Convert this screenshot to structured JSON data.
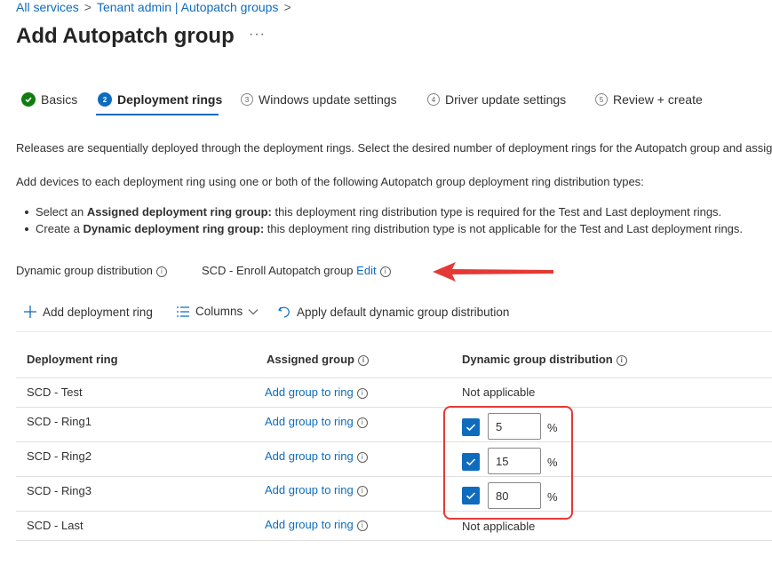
{
  "breadcrumb": [
    "All services",
    "Tenant admin | Autopatch groups"
  ],
  "page_title": "Add Autopatch group",
  "more_label": "···",
  "tabs": [
    {
      "label": "Basics",
      "num": "",
      "state": "done"
    },
    {
      "label": "Deployment rings",
      "num": "2",
      "state": "active"
    },
    {
      "label": "Windows update settings",
      "num": "3",
      "state": "pending"
    },
    {
      "label": "Driver update settings",
      "num": "4",
      "state": "pending"
    },
    {
      "label": "Review + create",
      "num": "5",
      "state": "pending"
    }
  ],
  "intro": "Releases are sequentially deployed through the deployment rings. Select the desired number of deployment rings for the Autopatch group and assign",
  "add_devices": "Add devices to each deployment ring using one or both of the following Autopatch group deployment ring distribution types:",
  "bullets": [
    {
      "pre": "Select an ",
      "bold": "Assigned deployment ring group:",
      "post": " this deployment ring distribution type is required for the Test and Last deployment rings."
    },
    {
      "pre": "Create a ",
      "bold": "Dynamic deployment ring group:",
      "post": " this deployment ring distribution type is not applicable for the Test and Last deployment rings."
    }
  ],
  "dynamic": {
    "label": "Dynamic group distribution",
    "group": "SCD - Enroll Autopatch group",
    "edit": "Edit"
  },
  "toolbar": {
    "add": "Add deployment ring",
    "columns": "Columns",
    "apply": "Apply default dynamic group distribution"
  },
  "table": {
    "headers": [
      "Deployment ring",
      "Assigned group",
      "Dynamic group distribution"
    ],
    "add_link": "Add group to ring",
    "not_applicable": "Not applicable",
    "pct_suffix": "%",
    "rows": [
      {
        "name": "SCD - Test",
        "dist": null
      },
      {
        "name": "SCD - Ring1",
        "dist": "5"
      },
      {
        "name": "SCD - Ring2",
        "dist": "15"
      },
      {
        "name": "SCD - Ring3",
        "dist": "80"
      },
      {
        "name": "SCD - Last",
        "dist": null
      }
    ]
  },
  "colors": {
    "accent": "#0f6cbd",
    "success": "#107c10",
    "annotation": "#e53935"
  },
  "icons": [
    "check-circle-icon",
    "info-icon",
    "plus-icon",
    "columns-icon",
    "chevron-down-icon",
    "undo-icon",
    "checkbox-checked-icon",
    "red-arrow-icon"
  ]
}
